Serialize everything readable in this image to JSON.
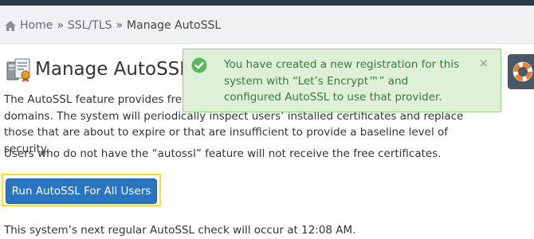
{
  "breadcrumb": {
    "home": "Home",
    "sep1": "»",
    "ssl": "SSL/TLS",
    "sep2": "»",
    "current": "Manage AutoSSL"
  },
  "page": {
    "title": "Manage AutoSSL",
    "intro": "The AutoSSL feature provides free domain-validated SSL certificates to your users’ domains. The system will periodically inspect users’ installed certificates and replace those that are about to expire or that are insufficient to provide a baseline level of security.",
    "feature_note": "Users who do not have the “autossl” feature will not receive the free certificates.",
    "next_check": "This system’s next regular AutoSSL check will occur at 12:08 AM."
  },
  "actions": {
    "run_label": "Run AutoSSL For All Users"
  },
  "alert": {
    "message": "You have created a new registration for this system with “Let’s Encrypt™” and configured AutoSSL to use that provider.",
    "close": "×",
    "type": "success"
  },
  "icons": {
    "home": "home-icon",
    "page": "ssl-certificate-icon",
    "alert": "check-circle-icon",
    "help": "lifebuoy-icon"
  },
  "colors": {
    "primary_button": "#2a74c0",
    "success_bg": "#dff0d8",
    "success_text": "#3c763d",
    "highlight": "#f6e21c"
  }
}
